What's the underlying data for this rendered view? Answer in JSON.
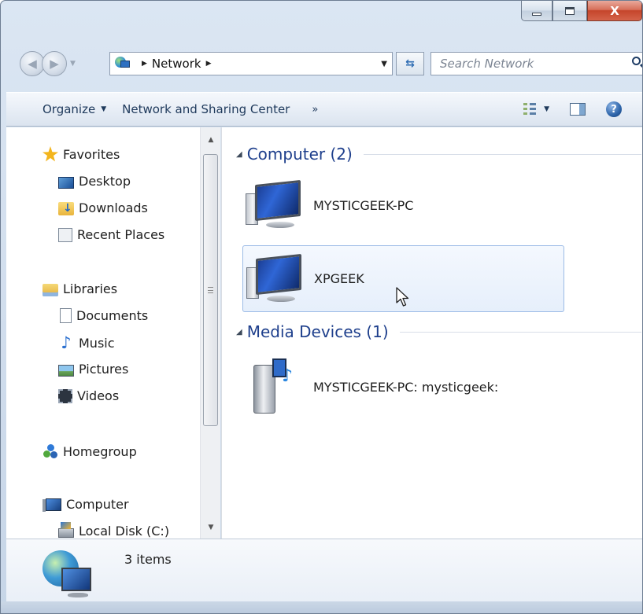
{
  "window": {
    "caption": {
      "minimize": "",
      "maximize": "",
      "close": "X"
    }
  },
  "navbar": {
    "back_icon": "back-arrow-icon",
    "forward_icon": "forward-arrow-icon",
    "address": {
      "location_icon": "network-icon",
      "segments": [
        "Network"
      ]
    },
    "search": {
      "placeholder": "Search Network"
    }
  },
  "commandbar": {
    "organize_label": "Organize",
    "network_sharing_label": "Network and Sharing Center",
    "more_label": "»"
  },
  "sidebar": {
    "items": [
      {
        "label": "Favorites",
        "icon": "star-icon"
      },
      {
        "label": "Desktop",
        "icon": "desktop-icon"
      },
      {
        "label": "Downloads",
        "icon": "downloads-folder-icon"
      },
      {
        "label": "Recent Places",
        "icon": "recent-places-icon"
      },
      {
        "label": "Libraries",
        "icon": "libraries-icon"
      },
      {
        "label": "Documents",
        "icon": "documents-icon"
      },
      {
        "label": "Music",
        "icon": "music-icon"
      },
      {
        "label": "Pictures",
        "icon": "pictures-icon"
      },
      {
        "label": "Videos",
        "icon": "videos-icon"
      },
      {
        "label": "Homegroup",
        "icon": "homegroup-icon"
      },
      {
        "label": "Computer",
        "icon": "computer-icon"
      },
      {
        "label": "Local Disk (C:)",
        "icon": "local-disk-icon"
      }
    ]
  },
  "main": {
    "groups": [
      {
        "title": "Computer (2)",
        "items": [
          {
            "label": "MYSTICGEEK-PC",
            "icon": "network-computer-icon",
            "selected": false
          },
          {
            "label": "XPGEEK",
            "icon": "network-computer-icon",
            "selected": true
          }
        ]
      },
      {
        "title": "Media Devices (1)",
        "items": [
          {
            "label": "MYSTICGEEK-PC: mysticgeek:",
            "icon": "media-device-icon",
            "selected": false
          }
        ]
      }
    ]
  },
  "details": {
    "count_text": "3 items",
    "icon": "network-globe-icon"
  },
  "colors": {
    "group_title": "#1e3f8c",
    "selection_border": "#9bbbe6",
    "close_button": "#c5452b"
  }
}
